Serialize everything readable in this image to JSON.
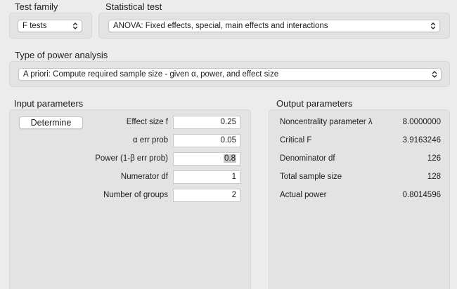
{
  "test_family": {
    "label": "Test family",
    "value": "F tests"
  },
  "statistical_test": {
    "label": "Statistical test",
    "value": "ANOVA: Fixed effects, special, main effects and interactions"
  },
  "power_analysis": {
    "label": "Type of power analysis",
    "value": "A priori: Compute required sample size - given α, power, and effect size"
  },
  "input": {
    "title": "Input parameters",
    "determine_label": "Determine",
    "params": [
      {
        "label": "Effect size f",
        "value": "0.25"
      },
      {
        "label": "α err prob",
        "value": "0.05"
      },
      {
        "label": "Power (1-β err prob)",
        "value": "0.8"
      },
      {
        "label": "Numerator df",
        "value": "1"
      },
      {
        "label": "Number of groups",
        "value": "2"
      }
    ]
  },
  "output": {
    "title": "Output parameters",
    "params": [
      {
        "label": "Noncentrality parameter λ",
        "value": "8.0000000"
      },
      {
        "label": "Critical F",
        "value": "3.9163246"
      },
      {
        "label": "Denominator df",
        "value": "126"
      },
      {
        "label": "Total sample size",
        "value": "128"
      },
      {
        "label": "Actual power",
        "value": "0.8014596"
      }
    ]
  },
  "icons": {
    "popup_arrows": "chevron-up-down-icon"
  }
}
